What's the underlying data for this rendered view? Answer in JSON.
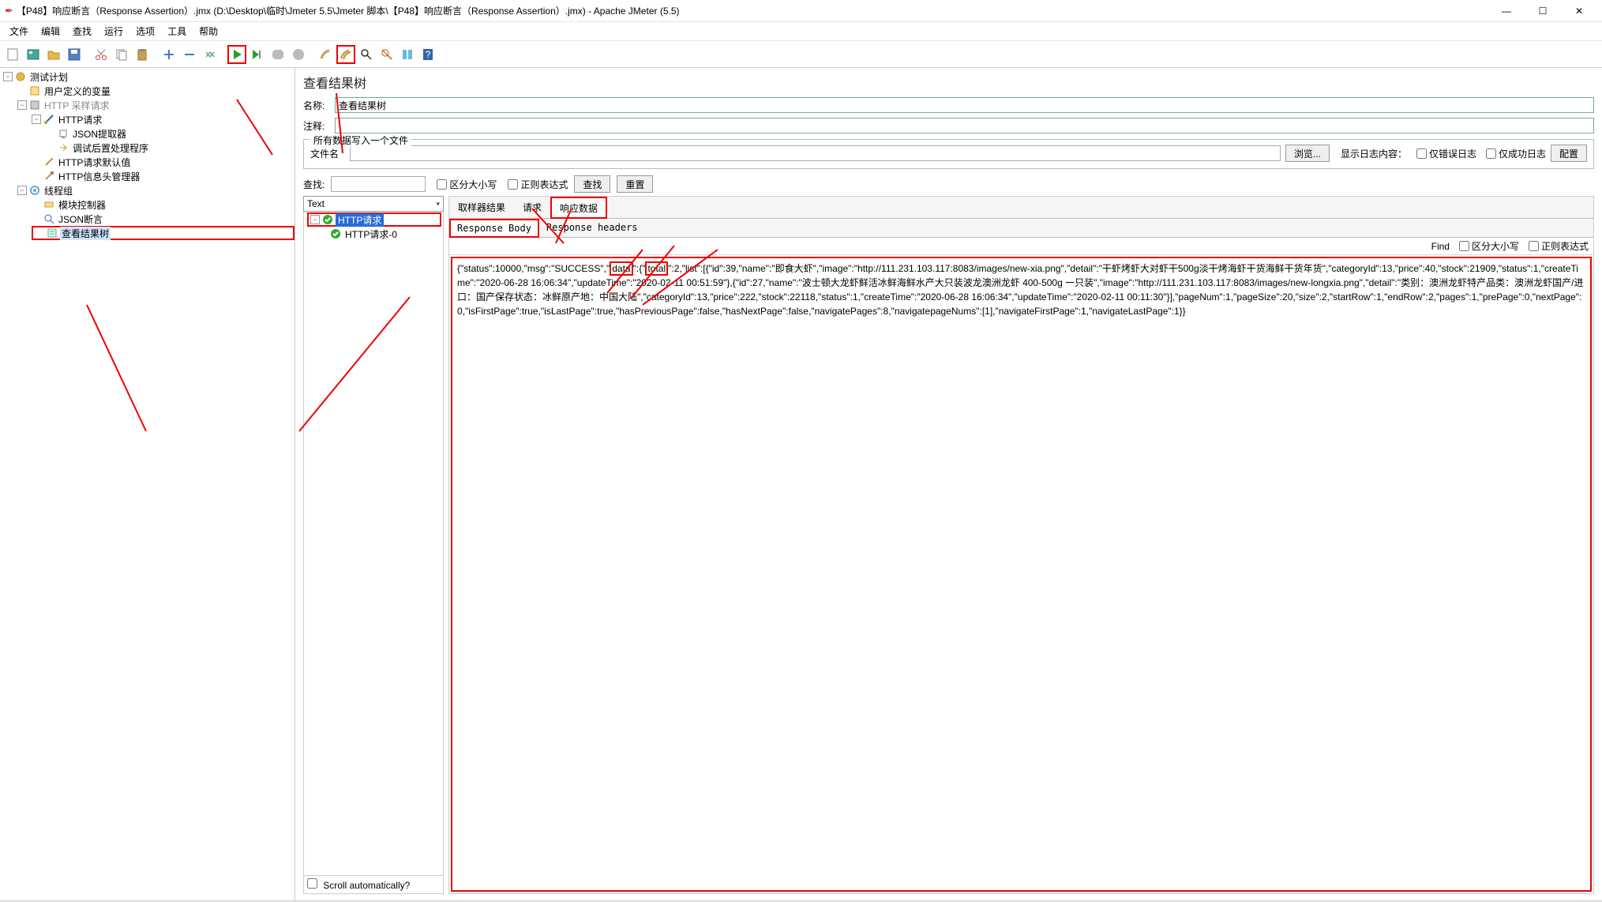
{
  "title": "【P48】响应断言（Response Assertion）.jmx (D:\\Desktop\\临时\\Jmeter 5.5\\Jmeter 脚本\\【P48】响应断言（Response Assertion）.jmx) - Apache JMeter (5.5)",
  "menu": {
    "file": "文件",
    "edit": "编辑",
    "search": "查找",
    "run": "运行",
    "options": "选项",
    "tools": "工具",
    "help": "帮助"
  },
  "tree": {
    "root": "测试计划",
    "udv": "用户定义的变量",
    "http_sampler": "HTTP 采样请求",
    "http_req": "HTTP请求",
    "json_ext": "JSON提取器",
    "post_proc": "调试后置处理程序",
    "http_def": "HTTP请求默认值",
    "http_hdr": "HTTP信息头管理器",
    "thread_group": "线程组",
    "module_ctrl": "模块控制器",
    "json_assert": "JSON断言",
    "view_results": "查看结果树"
  },
  "panel": {
    "title": "查看结果树",
    "name_label": "名称:",
    "name_value": "查看结果树",
    "comment_label": "注释:",
    "comment_value": "",
    "fileset_legend": "所有数据写入一个文件",
    "filename_label": "文件名",
    "filename_value": "",
    "browse": "浏览...",
    "showlog_label": "显示日志内容：",
    "only_error": "仅错误日志",
    "only_success": "仅成功日志",
    "config": "配置"
  },
  "searchbar": {
    "label": "查找:",
    "value": "",
    "case": "区分大小写",
    "regex": "正则表达式",
    "search": "查找",
    "reset": "重置"
  },
  "renderer": "Text",
  "results_tree": {
    "root": "HTTP请求",
    "child": "HTTP请求-0"
  },
  "scroll_auto": "Scroll automatically?",
  "tabs1": {
    "sampler": "取样器结果",
    "request": "请求",
    "response": "响应数据"
  },
  "tabs2": {
    "body": "Response Body",
    "headers": "Response headers"
  },
  "find": {
    "label": "Find",
    "case": "区分大小写",
    "regex": "正则表达式"
  },
  "response_parts": {
    "p1": "{\"status\":10000,\"msg\":\"SUCCESS\",\"",
    "hl1": "data",
    "p2": "\":{\"",
    "hl2": "total",
    "p3": "\":2,\"list\":[{\"id\":39,\"name\":\"即食大虾\",\"image\":\"http://111.231.103.117:8083/images/new-xia.png\",\"detail\":\"干虾烤虾大对虾干500g淡干烤海虾干货海鲜干货年货\",\"categoryId\":13,\"price\":40,\"stock\":21909,\"status\":1,\"createTime\":\"2020-06-28 16:06:34\",\"updateTime\":\"2020-02-11 00:51:59\"},{\"id\":27,\"name\":\"波士顿大龙虾鲜活冰鲜海鲜水产大只装波龙澳洲龙虾 400-500g 一只装\",\"image\":\"http://111.231.103.117:8083/images/new-longxia.png\",\"detail\":\"类别：澳洲龙虾特产品类：澳洲龙虾国产/进口：国产保存状态：冰鲜原产地：中国大陆\",\"categoryId\":13,\"price\":222,\"stock\":22118,\"status\":1,\"createTime\":\"2020-06-28 16:06:34\",\"updateTime\":\"2020-02-11 00:11:30\"}],\"pageNum\":1,\"pageSize\":20,\"size\":2,\"startRow\":1,\"endRow\":2,\"pages\":1,\"prePage\":0,\"nextPage\":0,\"isFirstPage\":true,\"isLastPage\":true,\"hasPreviousPage\":false,\"hasNextPage\":false,\"navigatePages\":8,\"navigatepageNums\":[1],\"navigateFirstPage\":1,\"navigateLastPage\":1}}"
  },
  "win": {
    "min": "—",
    "max": "☐",
    "close": "✕"
  }
}
